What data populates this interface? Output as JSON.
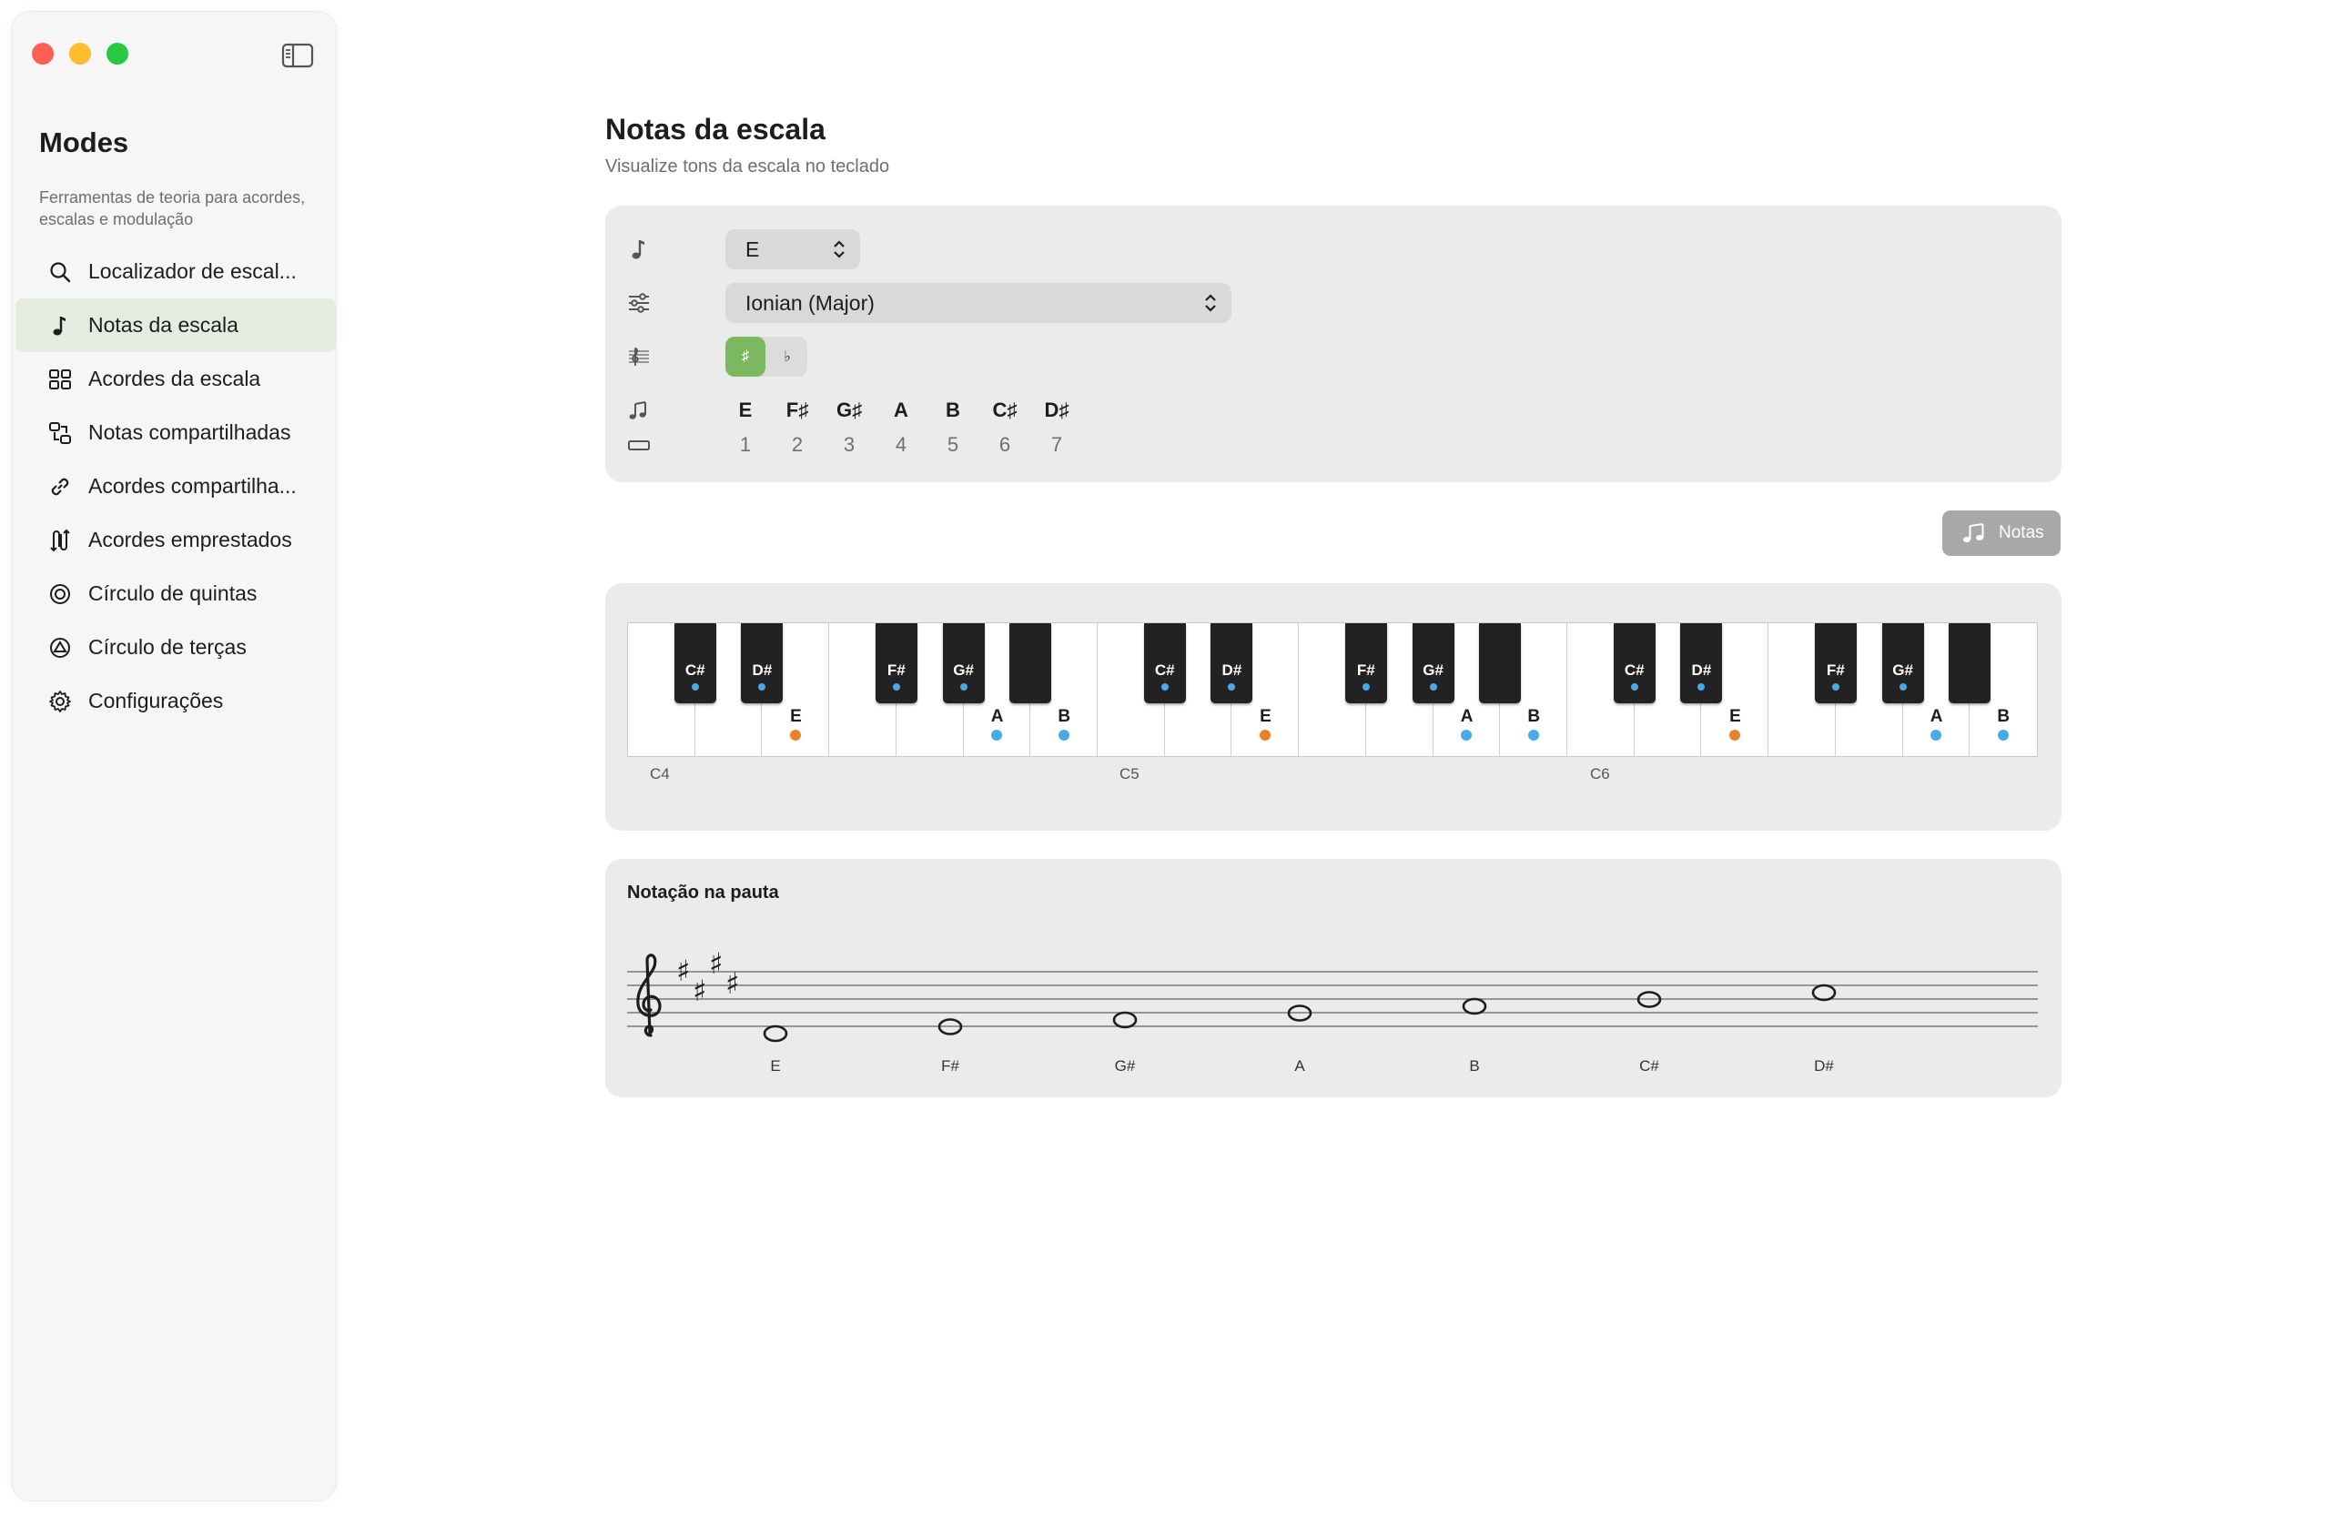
{
  "sidebar": {
    "title": "Modes",
    "subtitle": "Ferramentas de teoria para acordes, escalas e modulação",
    "items": [
      {
        "label": "Localizador de escal...",
        "icon": "search-icon",
        "active": false
      },
      {
        "label": "Notas da escala",
        "icon": "music-note-icon",
        "active": true
      },
      {
        "label": "Acordes da escala",
        "icon": "grid-icon",
        "active": false
      },
      {
        "label": "Notas compartilhadas",
        "icon": "shared-notes-icon",
        "active": false
      },
      {
        "label": "Acordes compartilha...",
        "icon": "link-icon",
        "active": false
      },
      {
        "label": "Acordes emprestados",
        "icon": "borrowed-icon",
        "active": false
      },
      {
        "label": "Círculo de quintas",
        "icon": "circle-icon",
        "active": false
      },
      {
        "label": "Círculo de terças",
        "icon": "triangle-circle-icon",
        "active": false
      },
      {
        "label": "Configurações",
        "icon": "gear-icon",
        "active": false
      }
    ]
  },
  "main": {
    "title": "Notas da escala",
    "subtitle": "Visualize tons da escala no teclado"
  },
  "controls": {
    "key_value": "E",
    "mode_value": "Ionian (Major)",
    "accidental_sharp": "♯",
    "accidental_flat": "♭",
    "scale_notes": [
      "E",
      "F♯",
      "G♯",
      "A",
      "B",
      "C♯",
      "D♯"
    ],
    "scale_degrees": [
      "1",
      "2",
      "3",
      "4",
      "5",
      "6",
      "7"
    ]
  },
  "notes_button": {
    "label": "Notas"
  },
  "piano": {
    "octave_labels": [
      "C4",
      "C5",
      "C6"
    ],
    "black_keys": [
      "C#",
      "D#",
      "",
      "F#",
      "G#",
      ""
    ],
    "white_key_labels": [
      "",
      "",
      "E",
      "",
      "",
      "A",
      "B"
    ],
    "colors": {
      "root": "#e8812a",
      "scale": "#4aaae8"
    }
  },
  "staff": {
    "title": "Notação na pauta",
    "notes": [
      "E",
      "F#",
      "G#",
      "A",
      "B",
      "C#",
      "D#"
    ]
  }
}
